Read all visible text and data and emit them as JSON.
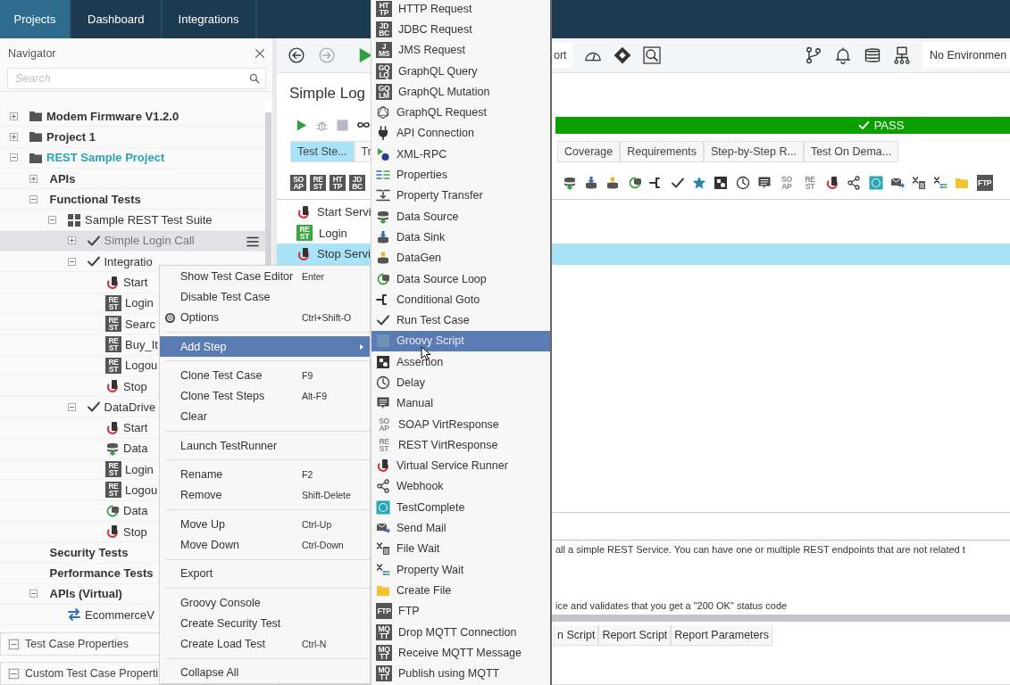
{
  "tabs": [
    {
      "label": "Projects",
      "selected": true
    },
    {
      "label": "Dashboard",
      "selected": false
    },
    {
      "label": "Integrations",
      "selected": false
    }
  ],
  "navigator": {
    "title": "Navigator",
    "search": {
      "placeholder": "Search"
    },
    "tree": [
      {
        "label": "Modem Firmware V1.2.0",
        "kind": "project",
        "expanded": false,
        "selected": false,
        "current": false
      },
      {
        "label": "Project 1",
        "kind": "project",
        "expanded": false,
        "selected": false,
        "current": false
      },
      {
        "label": "REST Sample Project",
        "kind": "project",
        "expanded": true,
        "selected": false,
        "current": true,
        "children": [
          {
            "label": "APIs",
            "kind": "group",
            "expanded": false,
            "selected": false
          },
          {
            "label": "Functional Tests",
            "kind": "group",
            "expanded": true,
            "selected": false,
            "children": [
              {
                "label": "Sample REST Test Suite",
                "kind": "suite",
                "expanded": true,
                "selected": false,
                "children": [
                  {
                    "label": "Simple Login Call",
                    "kind": "test-case",
                    "expanded": false,
                    "selected": true
                  },
                  {
                    "label": "Integratio",
                    "kind": "test-case",
                    "expanded": true,
                    "selected": false,
                    "children": [
                      {
                        "label": "Start",
                        "kind": "server-step",
                        "selected": false
                      },
                      {
                        "label": "Login",
                        "kind": "rest-step",
                        "badge": "RE ST",
                        "selected": false
                      },
                      {
                        "label": "Searc",
                        "kind": "rest-step",
                        "badge": "RE ST",
                        "selected": false
                      },
                      {
                        "label": "Buy_It",
                        "kind": "rest-step",
                        "badge": "RE ST",
                        "selected": false
                      },
                      {
                        "label": "Logou",
                        "kind": "rest-step",
                        "badge": "RE ST",
                        "selected": false
                      },
                      {
                        "label": "Stop",
                        "kind": "server-step",
                        "selected": false
                      }
                    ]
                  },
                  {
                    "label": "DataDrive",
                    "kind": "test-case",
                    "expanded": true,
                    "selected": false,
                    "children": [
                      {
                        "label": "Start",
                        "kind": "server-step",
                        "selected": false
                      },
                      {
                        "label": "Data",
                        "kind": "source-step",
                        "selected": false
                      },
                      {
                        "label": "Login",
                        "kind": "rest-step",
                        "badge": "RE ST",
                        "selected": false
                      },
                      {
                        "label": "Logou",
                        "kind": "rest-step",
                        "badge": "RE ST",
                        "selected": false
                      },
                      {
                        "label": "Data",
                        "kind": "loop-step",
                        "selected": false
                      },
                      {
                        "label": "Stop",
                        "kind": "server-step",
                        "selected": false
                      }
                    ]
                  }
                ]
              }
            ]
          },
          {
            "label": "Security Tests",
            "kind": "group",
            "selected": false
          },
          {
            "label": "Performance Tests",
            "kind": "group",
            "selected": false
          },
          {
            "label": "APIs (Virtual)",
            "kind": "group",
            "expanded": true,
            "selected": false,
            "children": [
              {
                "label": "EcommerceV",
                "kind": "virtual-api",
                "selected": false
              }
            ]
          }
        ]
      }
    ]
  },
  "panels": [
    {
      "label": "Test Case Properties"
    },
    {
      "label": "Custom Test Case Properti"
    }
  ],
  "editor": {
    "toolbar_button": "ort",
    "environment": "No Environmen",
    "title": "Simple Log",
    "status": {
      "text": "PASS",
      "kind": "pass"
    },
    "tabs": [
      {
        "label": "Test Ste...",
        "selected": true
      },
      {
        "label": "Tr",
        "selected": false
      },
      {
        "label": "Coverage",
        "selected": false
      },
      {
        "label": "Requirements",
        "selected": false
      },
      {
        "label": "Step-by-Step R...",
        "selected": false
      },
      {
        "label": "Test On Dema...",
        "selected": false
      }
    ],
    "step_badges": [
      {
        "badge": "SO AP"
      },
      {
        "badge": "RE ST"
      },
      {
        "badge": "HT TP"
      },
      {
        "badge": "JD BC"
      }
    ],
    "step_tools": [
      {
        "kind": "data-source"
      },
      {
        "kind": "data-sink"
      },
      {
        "kind": "datagen"
      },
      {
        "kind": "data-source-loop"
      },
      {
        "kind": "conditional-goto"
      },
      {
        "kind": "run-test-case"
      },
      {
        "kind": "star"
      },
      {
        "kind": "assertion"
      },
      {
        "kind": "delay"
      },
      {
        "kind": "manual"
      },
      {
        "kind": "soap-virt",
        "badge": "SO AP"
      },
      {
        "kind": "rest-virt",
        "badge": "RE ST"
      },
      {
        "kind": "virt-runner"
      },
      {
        "kind": "webhook"
      },
      {
        "kind": "testcomplete"
      },
      {
        "kind": "send-mail"
      },
      {
        "kind": "file-wait"
      },
      {
        "kind": "property-wait"
      },
      {
        "kind": "create-file"
      },
      {
        "kind": "ftp",
        "badge": "FTP"
      }
    ],
    "steps": [
      {
        "label": "Start Servi",
        "kind": "server-step",
        "selected": false
      },
      {
        "label": "Login",
        "kind": "rest",
        "badge": "RE ST",
        "selected": false
      },
      {
        "label": "Stop Servi",
        "kind": "server-step",
        "selected": true
      }
    ],
    "description": [
      "all a simple REST Service. You can have one or multiple REST endpoints that are not related t",
      "ice and validates that you get a \"200 OK\" status code"
    ],
    "bottom_tabs": [
      {
        "label": "n Script",
        "selected": false
      },
      {
        "label": "Report Script",
        "selected": false
      },
      {
        "label": "Report Parameters",
        "selected": false
      }
    ]
  },
  "context_menu": {
    "groups": [
      [
        {
          "label": "Show Test Case Editor",
          "shortcut": "Enter",
          "kind": "command",
          "selected": false
        },
        {
          "label": "Disable Test Case",
          "kind": "command",
          "selected": false
        },
        {
          "label": "Options",
          "shortcut": "Ctrl+Shift-O",
          "kind": "settings",
          "selected": false
        }
      ],
      [
        {
          "label": "Add Step",
          "kind": "submenu",
          "selected": true
        }
      ],
      [
        {
          "label": "Clone Test Case",
          "shortcut": "F9",
          "kind": "command",
          "selected": false
        },
        {
          "label": "Clone Test Steps",
          "shortcut": "Alt-F9",
          "kind": "command",
          "selected": false
        },
        {
          "label": "Clear",
          "kind": "command",
          "selected": false
        }
      ],
      [
        {
          "label": "Launch TestRunner",
          "kind": "command",
          "selected": false
        }
      ],
      [
        {
          "label": "Rename",
          "shortcut": "F2",
          "kind": "command",
          "selected": false
        },
        {
          "label": "Remove",
          "shortcut": "Shift-Delete",
          "kind": "command",
          "selected": false
        }
      ],
      [
        {
          "label": "Move Up",
          "shortcut": "Ctrl-Up",
          "kind": "command",
          "selected": false
        },
        {
          "label": "Move Down",
          "shortcut": "Ctrl-Down",
          "kind": "command",
          "selected": false
        }
      ],
      [
        {
          "label": "Export",
          "kind": "command",
          "selected": false
        }
      ],
      [
        {
          "label": "Groovy Console",
          "kind": "command",
          "selected": false
        },
        {
          "label": "Create Security Test",
          "kind": "command",
          "selected": false
        },
        {
          "label": "Create Load Test",
          "shortcut": "Ctrl-N",
          "kind": "command",
          "selected": false
        }
      ],
      [
        {
          "label": "Collapse All",
          "kind": "command",
          "selected": false
        }
      ]
    ]
  },
  "submenu": {
    "items": [
      {
        "label": "HTTP Request",
        "kind": "http",
        "badge": "HT TP",
        "selected": false
      },
      {
        "label": "JDBC Request",
        "kind": "jdbc",
        "badge": "JD BC",
        "selected": false
      },
      {
        "label": "JMS Request",
        "kind": "jms",
        "badge": "J MS",
        "selected": false
      },
      {
        "label": "GraphQL Query",
        "kind": "graphql-query",
        "badge": "GQ LQ",
        "selected": false
      },
      {
        "label": "GraphQL Mutation",
        "kind": "graphql-mutation",
        "badge": "GQ LM",
        "selected": false
      },
      {
        "label": "GraphQL Request",
        "kind": "graphql-request",
        "selected": false
      },
      {
        "label": "API Connection",
        "kind": "api-connection",
        "selected": false
      },
      {
        "label": "XML-RPC",
        "kind": "xml-rpc",
        "selected": false
      },
      {
        "label": "Properties",
        "kind": "properties",
        "selected": false
      },
      {
        "label": "Property Transfer",
        "kind": "property-transfer",
        "selected": false
      },
      {
        "label": "Data Source",
        "kind": "data-source",
        "selected": false
      },
      {
        "label": "Data Sink",
        "kind": "data-sink",
        "selected": false
      },
      {
        "label": "DataGen",
        "kind": "datagen",
        "selected": false
      },
      {
        "label": "Data Source Loop",
        "kind": "data-source-loop",
        "selected": false
      },
      {
        "label": "Conditional Goto",
        "kind": "conditional-goto",
        "selected": false
      },
      {
        "label": "Run Test Case",
        "kind": "run-test-case",
        "selected": false
      },
      {
        "label": "Groovy Script",
        "kind": "groovy-script",
        "selected": true
      },
      {
        "label": "Assertion",
        "kind": "assertion",
        "selected": false
      },
      {
        "label": "Delay",
        "kind": "delay",
        "selected": false
      },
      {
        "label": "Manual",
        "kind": "manual",
        "selected": false
      },
      {
        "label": "SOAP VirtResponse",
        "kind": "soap-virt",
        "badge": "SO AP",
        "selected": false
      },
      {
        "label": "REST VirtResponse",
        "kind": "rest-virt",
        "badge": "RE ST",
        "selected": false
      },
      {
        "label": "Virtual Service Runner",
        "kind": "virt-runner",
        "selected": false
      },
      {
        "label": "Webhook",
        "kind": "webhook",
        "selected": false
      },
      {
        "label": "TestComplete",
        "kind": "testcomplete",
        "selected": false
      },
      {
        "label": "Send Mail",
        "kind": "send-mail",
        "selected": false
      },
      {
        "label": "File Wait",
        "kind": "file-wait",
        "selected": false
      },
      {
        "label": "Property Wait",
        "kind": "property-wait",
        "selected": false
      },
      {
        "label": "Create File",
        "kind": "create-file",
        "selected": false
      },
      {
        "label": "FTP",
        "kind": "ftp",
        "badge": "FTP",
        "selected": false
      },
      {
        "label": "Drop MQTT Connection",
        "kind": "mqtt-drop",
        "badge": "MQ TT",
        "selected": false
      },
      {
        "label": "Receive MQTT Message",
        "kind": "mqtt-receive",
        "badge": "MQ TT",
        "selected": false
      },
      {
        "label": "Publish using MQTT",
        "kind": "mqtt-publish",
        "badge": "MQ TT",
        "selected": false
      }
    ]
  }
}
